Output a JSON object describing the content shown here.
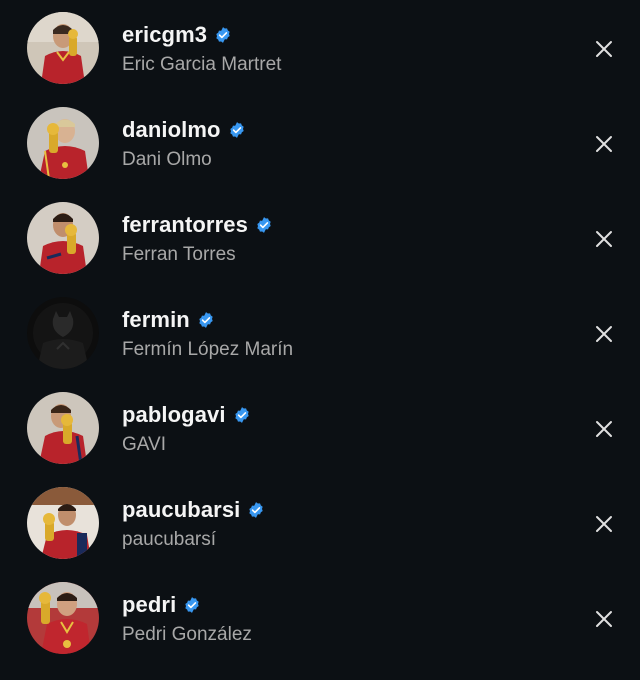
{
  "accounts": [
    {
      "username": "ericgm3",
      "full_name": "Eric Garcia Martret",
      "verified": true,
      "avatar": "player-with-trophy-avatar"
    },
    {
      "username": "daniolmo",
      "full_name": "Dani Olmo",
      "verified": true,
      "avatar": "player-with-trophy-avatar"
    },
    {
      "username": "ferrantorres",
      "full_name": "Ferran Torres",
      "verified": true,
      "avatar": "player-with-trophy-avatar"
    },
    {
      "username": "fermin",
      "full_name": "Fermín López Marín",
      "verified": true,
      "avatar": "dark-figure-avatar"
    },
    {
      "username": "pablogavi",
      "full_name": "GAVI",
      "verified": true,
      "avatar": "player-with-trophy-avatar"
    },
    {
      "username": "paucubarsi",
      "full_name": "paucubarsí",
      "verified": true,
      "avatar": "player-with-trophy-avatar"
    },
    {
      "username": "pedri",
      "full_name": "Pedri González",
      "verified": true,
      "avatar": "player-with-trophy-avatar"
    }
  ],
  "colors": {
    "background": "#0c1014",
    "username": "#f5f5f5",
    "full_name": "#a8a8a8",
    "verified_badge": "#3897f0",
    "close_icon": "#e0e0e0"
  },
  "icons": {
    "verified": "verified-badge-icon",
    "close": "close-icon"
  }
}
